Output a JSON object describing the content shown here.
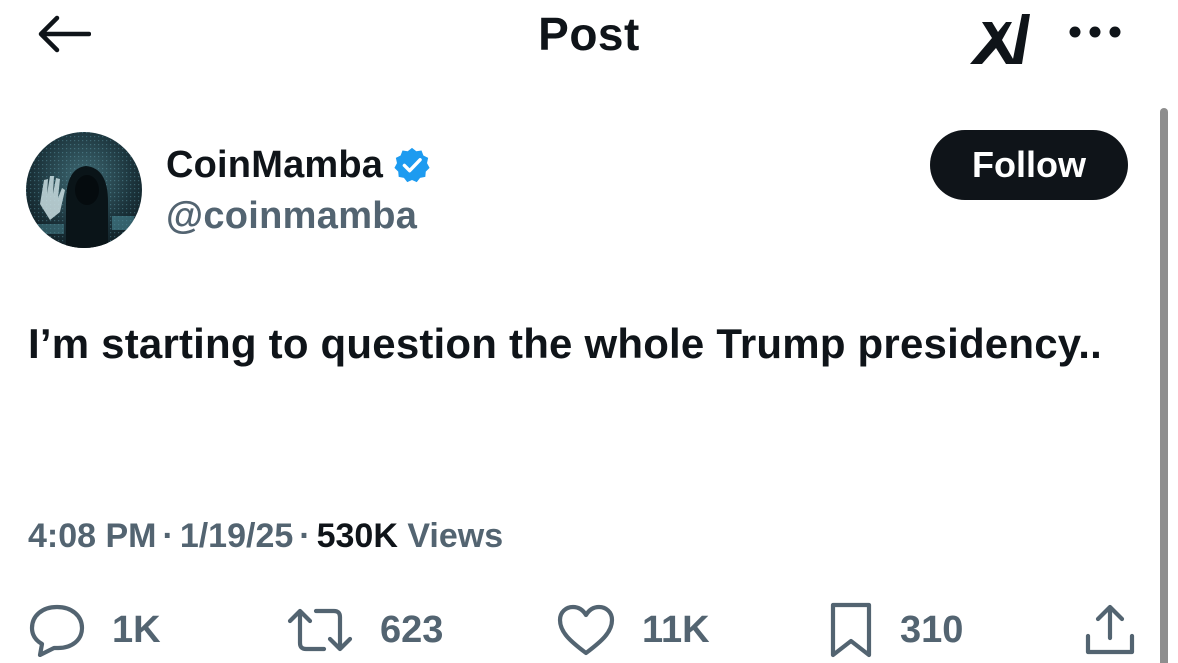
{
  "header": {
    "title": "Post",
    "back_icon": "arrow-left-icon",
    "grok_icon": "grok-icon",
    "more_icon": "more-horizontal-icon"
  },
  "author": {
    "display_name": "CoinMamba",
    "handle": "@coinmamba",
    "verified": true,
    "verified_color": "#1d9bf0",
    "follow_label": "Follow"
  },
  "post": {
    "text": "I’m starting to question the whole Trump presidency.."
  },
  "meta": {
    "time": "4:08 PM",
    "separator": "·",
    "date": "1/19/25",
    "views_count": "530K",
    "views_label": "Views"
  },
  "actions": {
    "replies": {
      "icon": "reply-icon",
      "count": "1K"
    },
    "reposts": {
      "icon": "repost-icon",
      "count": "623"
    },
    "likes": {
      "icon": "heart-icon",
      "count": "11K"
    },
    "bookmarks": {
      "icon": "bookmark-icon",
      "count": "310"
    },
    "share": {
      "icon": "share-icon"
    }
  },
  "colors": {
    "text_primary": "#0f1419",
    "text_secondary": "#536471",
    "follow_bg": "#0f1419",
    "follow_text": "#ffffff"
  }
}
